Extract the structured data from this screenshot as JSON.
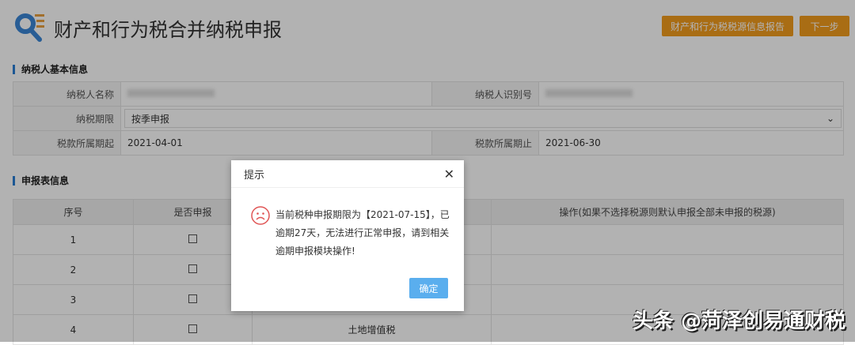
{
  "header": {
    "title": "财产和行为税合并纳税申报",
    "report_button": "财产和行为税税源信息报告",
    "next_button": "下一步"
  },
  "basic_info": {
    "section_title": "纳税人基本信息",
    "name_label": "纳税人名称",
    "id_label": "纳税人识别号",
    "period_label": "纳税期限",
    "period_value": "按季申报",
    "start_label": "税款所属期起",
    "start_value": "2021-04-01",
    "end_label": "税款所属期止",
    "end_value": "2021-06-30"
  },
  "declaration": {
    "section_title": "申报表信息",
    "columns": [
      "序号",
      "是否申报",
      "",
      "操作(如果不选择税源则默认申报全部未申报的税源)"
    ],
    "rows": [
      {
        "no": "1",
        "item": ""
      },
      {
        "no": "2",
        "item": ""
      },
      {
        "no": "3",
        "item": ""
      },
      {
        "no": "4",
        "item": "土地增值税"
      }
    ]
  },
  "dialog": {
    "title": "提示",
    "message": "当前税种申报期限为【2021-07-15】，已逾期27天，无法进行正常申报，请到相关逾期申报模块操作!",
    "ok_button": "确定"
  },
  "watermark": "头条 @菏泽创易通财税",
  "colors": {
    "accent": "#f39c1e",
    "primary": "#5aaeee",
    "section_bar": "#2a7fd4"
  }
}
